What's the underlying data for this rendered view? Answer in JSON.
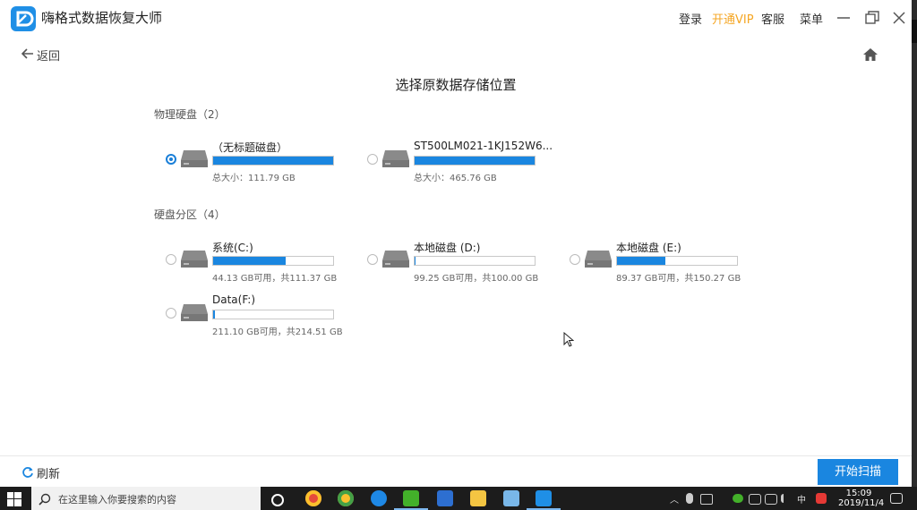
{
  "window": {
    "app_title": "嗨格式数据恢复大师",
    "links": {
      "login": "登录",
      "vip": "开通VIP",
      "support": "客服",
      "menu": "菜单"
    }
  },
  "nav": {
    "back_label": "返回"
  },
  "page": {
    "title": "选择原数据存储位置"
  },
  "physical": {
    "label": "物理硬盘（2）",
    "disks": [
      {
        "name": "（无标题磁盘）",
        "info": "总大小：111.79 GB",
        "fill": 1.0,
        "selected": true
      },
      {
        "name": "ST500LM021-1KJ152W6...",
        "info": "总大小：465.76 GB",
        "fill": 1.0,
        "selected": false
      }
    ]
  },
  "partitions": {
    "label": "硬盘分区（4）",
    "items": [
      {
        "name": "系统(C:)",
        "info": "44.13 GB可用，共111.37 GB",
        "fill": 0.604
      },
      {
        "name": "本地磁盘 (D:)",
        "info": "99.25 GB可用，共100.00 GB",
        "fill": 0.0075
      },
      {
        "name": "本地磁盘 (E:)",
        "info": "89.37 GB可用，共150.27 GB",
        "fill": 0.405
      },
      {
        "name": "Data(F:)",
        "info": "211.10 GB可用，共214.51 GB",
        "fill": 0.016
      }
    ]
  },
  "footer": {
    "refresh_label": "刷新",
    "start_label": "开始扫描"
  },
  "taskbar": {
    "search_placeholder": "在这里输入你要搜索的内容",
    "ime": "中",
    "time": "15:09",
    "date": "2019/11/4"
  },
  "colors": {
    "accent": "#1a86e0",
    "vip": "#f5a623",
    "taskbar": "#1c1c1c"
  },
  "icons": [
    "app-logo-icon",
    "minimize-icon",
    "restore-icon",
    "close-icon",
    "back-arrow-icon",
    "home-icon",
    "disk-icon",
    "refresh-icon",
    "windows-start-icon",
    "search-icon"
  ]
}
